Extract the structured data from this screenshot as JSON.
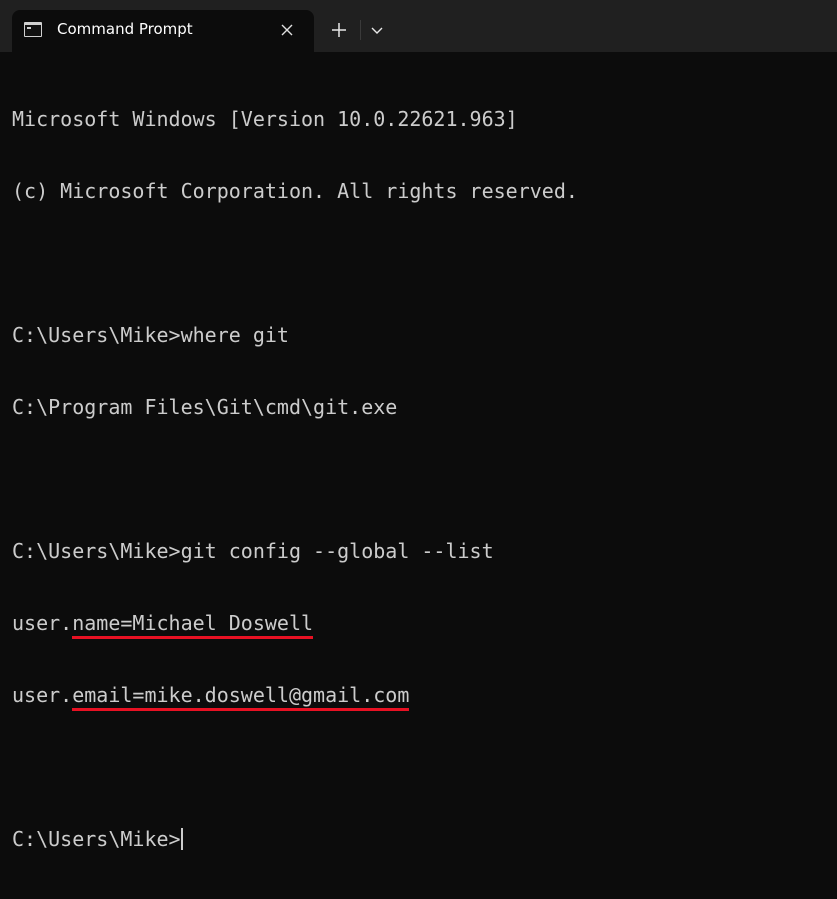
{
  "tab": {
    "title": "Command Prompt"
  },
  "console": {
    "lines": [
      "Microsoft Windows [Version 10.0.22621.963]",
      "(c) Microsoft Corporation. All rights reserved.",
      "",
      "C:\\Users\\Mike>where git",
      "C:\\Program Files\\Git\\cmd\\git.exe",
      "",
      "C:\\Users\\Mike>git config --global --list"
    ],
    "name_prefix": "user.",
    "name_value": "name=Michael Doswell",
    "email_prefix": "user.",
    "email_value": "email=mike.doswell@gmail.com",
    "prompt": "C:\\Users\\Mike>"
  },
  "colors": {
    "background": "#0c0c0c",
    "titlebar": "#202020",
    "text": "#cccccc",
    "underline": "#e81123"
  },
  "icons": {
    "tab": "terminal-icon",
    "close": "close-icon",
    "new_tab": "plus-icon",
    "dropdown": "chevron-down-icon"
  }
}
